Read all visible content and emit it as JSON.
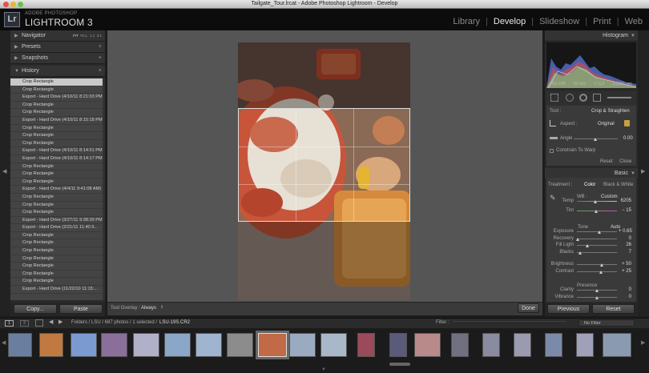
{
  "window": {
    "title": "Tailgate_Tour.lrcat - Adobe Photoshop Lightroom - Develop"
  },
  "app": {
    "logo": "Lr",
    "vendor": "ADOBE PHOTOSHOP",
    "product": "LIGHTROOM 3"
  },
  "modules": [
    {
      "label": "Library",
      "active": false
    },
    {
      "label": "Develop",
      "active": true
    },
    {
      "label": "Slideshow",
      "active": false
    },
    {
      "label": "Print",
      "active": false
    },
    {
      "label": "Web",
      "active": false
    }
  ],
  "left_panel": {
    "navigator": {
      "title": "Navigator",
      "zoom_options": [
        "FIT",
        "FILL",
        "1:1",
        "3:1"
      ]
    },
    "presets": {
      "title": "Presets"
    },
    "snapshots": {
      "title": "Snapshots"
    },
    "history": {
      "title": "History",
      "items": [
        "Crop Rectangle",
        "Crop Rectangle",
        "Export - Hard Drive (4/10/11 8:21:03 PM)",
        "Crop Rectangle",
        "Crop Rectangle",
        "Export - Hard Drive (4/10/11 8:15:18 PM)",
        "Crop Rectangle",
        "Crop Rectangle",
        "Crop Rectangle",
        "Export - Hard Drive (4/10/11 8:14:51 PM)",
        "Export - Hard Drive (4/10/11 8:14:17 PM)",
        "Crop Rectangle",
        "Crop Rectangle",
        "Crop Rectangle",
        "Export - Hard Drive (4/4/11 9:41:08 AM)",
        "Crop Rectangle",
        "Crop Rectangle",
        "Crop Rectangle",
        "Export - Hard Drive (3/27/11 9:38:39 PM)",
        "Export - Hard Drive (2/21/11 11:40:3...",
        "Crop Rectangle",
        "Crop Rectangle",
        "Crop Rectangle",
        "Crop Rectangle",
        "Crop Rectangle",
        "Crop Rectangle",
        "Crop Rectangle",
        "Export - Hard Drive (11/22/10 11:15:..."
      ]
    },
    "copy_label": "Copy...",
    "paste_label": "Paste"
  },
  "toolbar": {
    "overlay_label": "Tool Overlay :",
    "overlay_value": "Always",
    "done_label": "Done"
  },
  "right_panel": {
    "histogram": {
      "title": "Histogram",
      "info": [
        "ISO 100",
        "50 mm",
        "f / 3.2",
        "1/1600 sec"
      ]
    },
    "crop": {
      "tool_label": "Tool :",
      "tool_value": "Crop & Straighten",
      "aspect_label": "Aspect :",
      "aspect_value": "Original",
      "angle_label": "Angle",
      "angle_value": "0.00",
      "constrain_label": "Constrain To Warp",
      "reset_label": "Reset",
      "close_label": "Close"
    },
    "basic": {
      "title": "Basic",
      "treatment_label": "Treatment :",
      "color_label": "Color",
      "bw_label": "Black & White",
      "wb_label": "WB :",
      "wb_value": "Custom",
      "temp": {
        "label": "Temp",
        "value": "6205",
        "level": 0.45
      },
      "tint": {
        "label": "Tint",
        "value": "− 15",
        "level": 0.47
      },
      "tone_label": "Tone",
      "auto_label": "Auto",
      "exposure": {
        "label": "Exposure",
        "value": "+ 0.65",
        "level": 0.55
      },
      "recovery": {
        "label": "Recovery",
        "value": "0",
        "level": 0.02
      },
      "fill_light": {
        "label": "Fill Light",
        "value": "26",
        "level": 0.26
      },
      "blacks": {
        "label": "Blacks",
        "value": "7",
        "level": 0.07
      },
      "brightness": {
        "label": "Brightness",
        "value": "+ 50",
        "level": 0.62
      },
      "contrast": {
        "label": "Contrast",
        "value": "+ 25",
        "level": 0.6
      },
      "presence_label": "Presence",
      "clarity": {
        "label": "Clarity",
        "value": "0",
        "level": 0.5
      },
      "vibrance": {
        "label": "Vibrance",
        "value": "0",
        "level": 0.5
      }
    },
    "previous_label": "Previous",
    "reset_label": "Reset"
  },
  "filmstrip": {
    "page1": "1",
    "page2": "2",
    "path": "Folders / LSU / 687 photos / 1 selected /",
    "filename": "LSU-19S.CR2",
    "filter_label": "Filter :",
    "filter_value": "No Filter"
  },
  "colors": {
    "accent": "#d9d9d9",
    "panel": "#2a2a2a",
    "photo_red": "#b5432c",
    "photo_yellow": "#e3a84a"
  }
}
